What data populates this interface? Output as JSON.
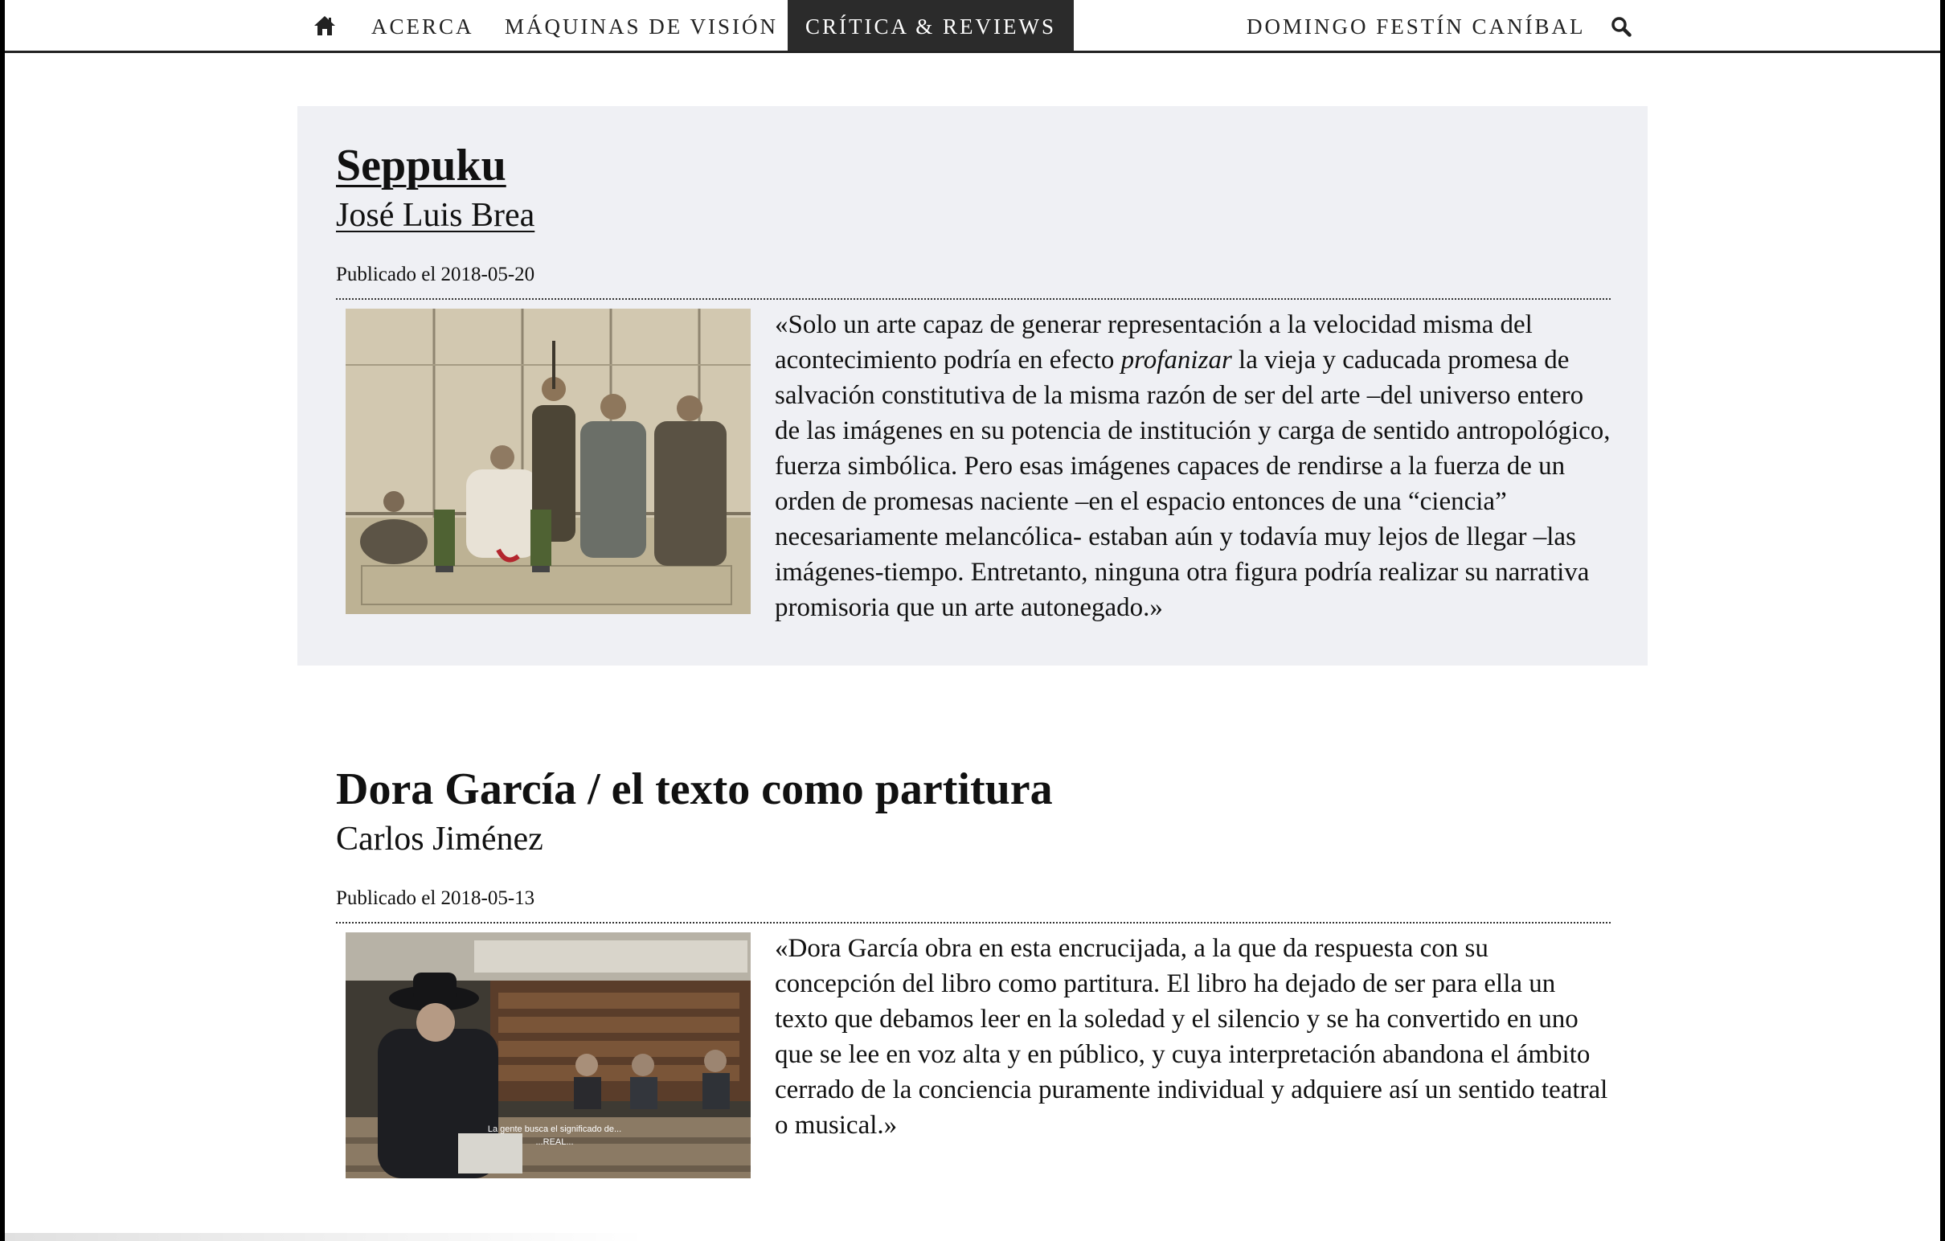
{
  "nav": {
    "home_icon": "home-icon",
    "items": [
      {
        "label": "ACERCA"
      },
      {
        "label": "MÁQUINAS DE VISIÓN"
      },
      {
        "label": "CRÍTICA & REVIEWS",
        "active": true
      },
      {
        "label": "DOMINGO FESTÍN CANÍBAL"
      }
    ],
    "search_icon": "search-icon",
    "active_color": "#2b2b2b"
  },
  "articles": [
    {
      "title": "Seppuku",
      "author": "José Luis Brea",
      "date": "Publicado el 2018-05-20",
      "image_icon": "seppuku-photo",
      "excerpt_before": "«Solo un arte capaz de generar representación a la velocidad misma del acontecimiento podría en efecto ",
      "excerpt_em": "profanizar",
      "excerpt_after": " la vieja y caducada promesa de salvación constitutiva de la misma razón de ser del arte –del universo entero de las imágenes en su potencia de institución y carga de sentido antropológico, fuerza simbólica. Pero esas imágenes capaces de rendirse a la fuerza de un orden de promesas naciente –en el espacio entonces de una “ciencia” necesariamente melancólica- estaban aún y todavía muy lejos de llegar –las imágenes-tiempo. Entretanto, ninguna otra figura podría realizar su narrativa promisoria que un arte autonegado.»",
      "background": "#eff0f4"
    },
    {
      "title": "Dora García / el texto como partitura",
      "author": "Carlos Jiménez",
      "date": "Publicado el 2018-05-13",
      "image_icon": "library-reading-photo",
      "image_caption_1": "La gente busca el significado de...",
      "image_caption_2": "...REAL...",
      "excerpt": "«Dora García obra en esta encrucijada, a la que da respuesta con su concepción del libro como partitura. El libro ha dejado de ser para ella un texto que debamos leer en la soledad y el silencio y se ha convertido en uno que se lee en voz alta y en público, y cuya interpretación abandona el ámbito cerrado de la conciencia puramente individual y adquiere así un sentido teatral o musical.»"
    }
  ]
}
